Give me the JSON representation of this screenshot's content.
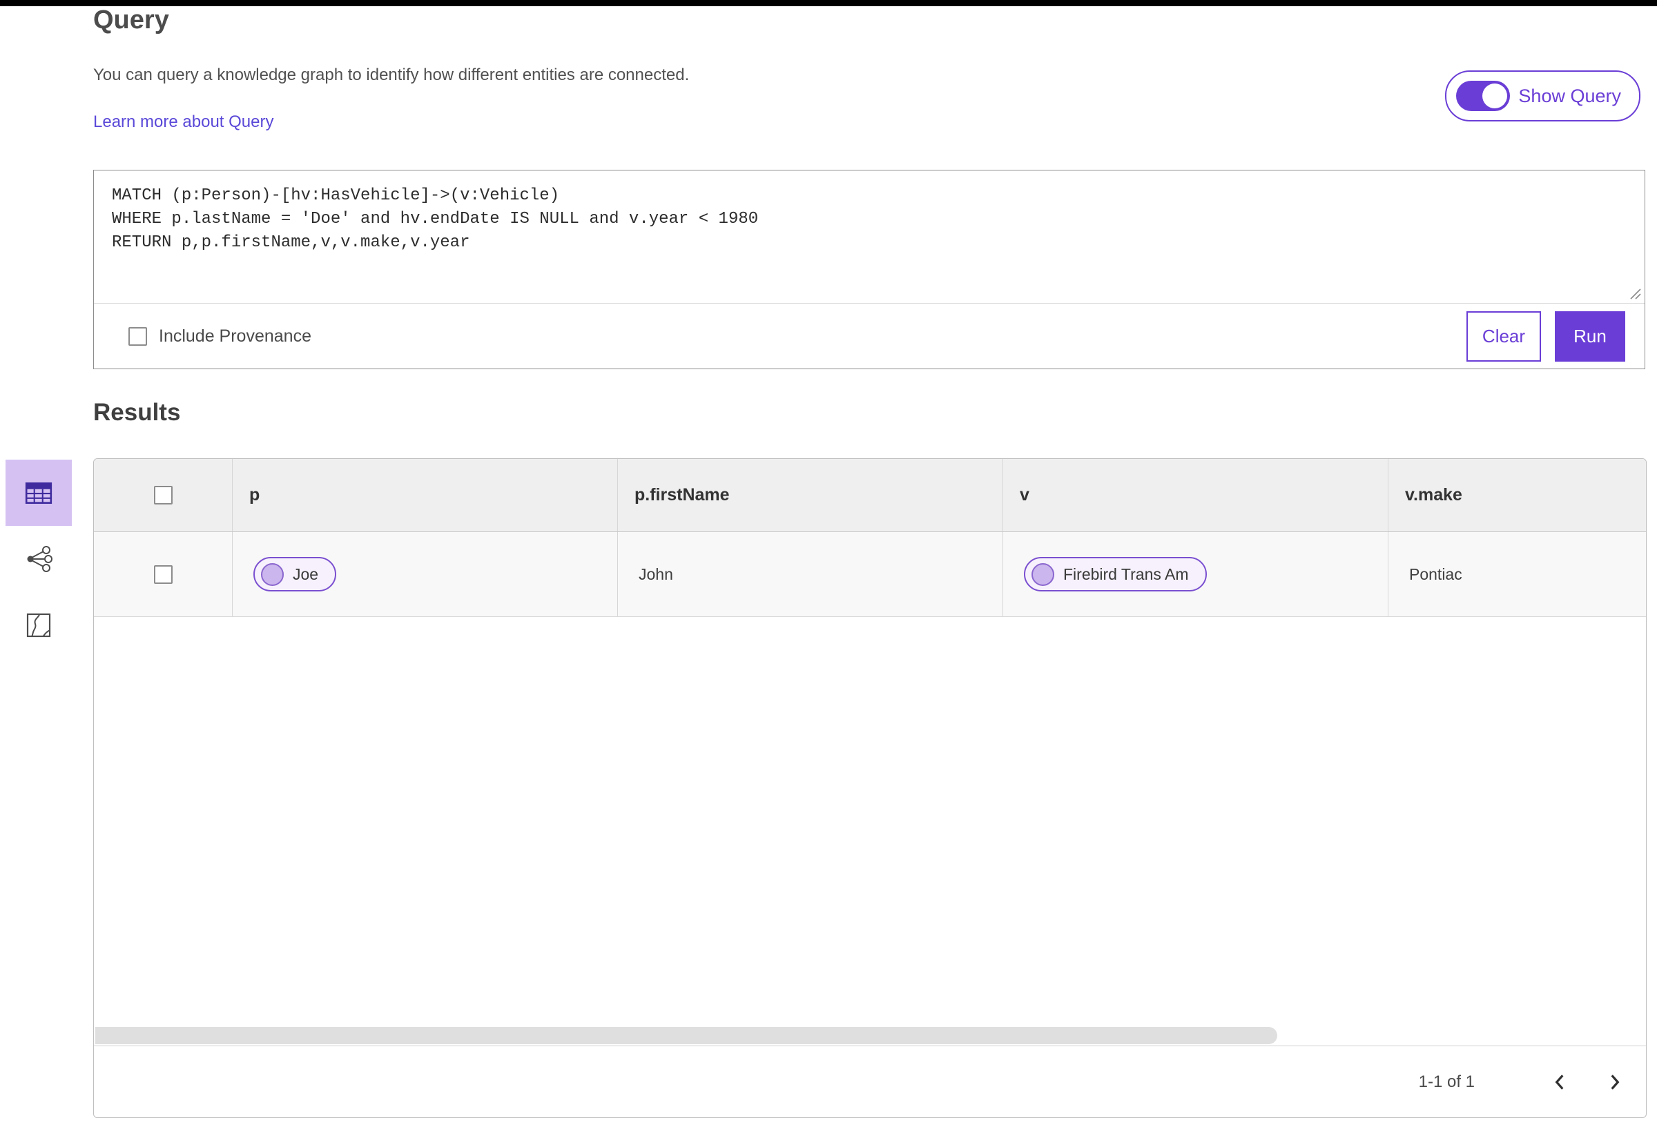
{
  "header": {
    "title": "Query",
    "description": "You can query a knowledge graph to identify how different entities are connected.",
    "learn_more": "Learn more about Query",
    "show_query_label": "Show Query"
  },
  "query_editor": {
    "code": "MATCH (p:Person)-[hv:HasVehicle]->(v:Vehicle)\nWHERE p.lastName = 'Doe' and hv.endDate IS NULL and v.year < 1980\nRETURN p,p.firstName,v,v.make,v.year",
    "include_provenance_label": "Include Provenance",
    "clear_label": "Clear",
    "run_label": "Run"
  },
  "results": {
    "title": "Results",
    "view_icons": [
      "table-view",
      "link-chart-view",
      "map-view"
    ],
    "selected_view": "table-view",
    "columns": [
      "p",
      "p.firstName",
      "v",
      "v.make"
    ],
    "rows": [
      {
        "p": "Joe",
        "p_firstName": "John",
        "v": "Firebird Trans Am",
        "v_make": "Pontiac"
      }
    ],
    "pagination": "1-1 of 1"
  },
  "colors": {
    "accent": "#6a3ed6",
    "accent_dark": "#3f2b9e",
    "selected_view_bg": "#d5c2f2",
    "chip_border": "#7a4fd0",
    "chip_bg": "#f6f1fc",
    "header_row_bg": "#efefef",
    "row_bg": "#f8f8f8",
    "link": "#5a49d8"
  }
}
